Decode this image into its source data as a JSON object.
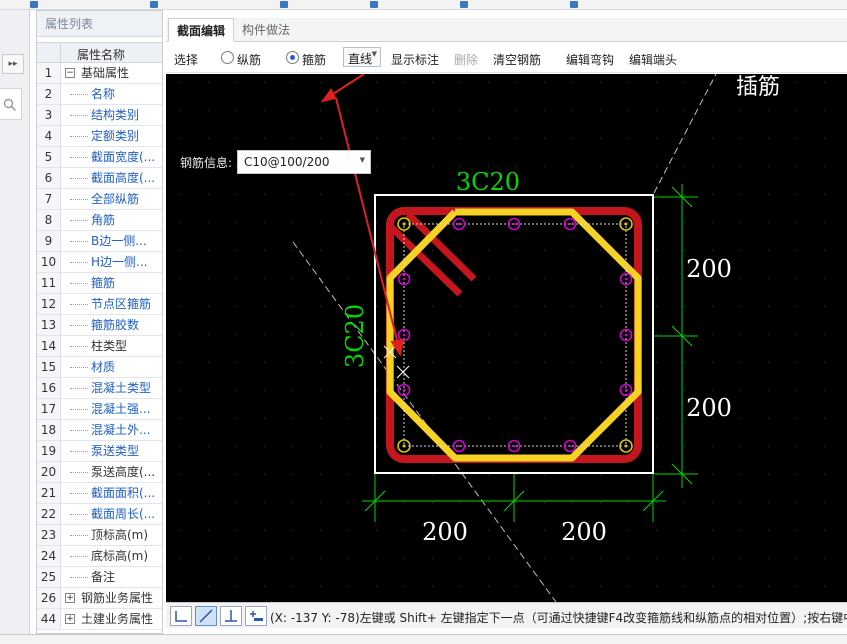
{
  "prop_panel": {
    "title": "属性列表",
    "col_header": "属性名称",
    "rows": [
      {
        "n": "1",
        "label": "基础属性",
        "type": "group",
        "open": true
      },
      {
        "n": "2",
        "label": "名称",
        "blue": true
      },
      {
        "n": "3",
        "label": "结构类别",
        "blue": true
      },
      {
        "n": "4",
        "label": "定额类别",
        "blue": true
      },
      {
        "n": "5",
        "label": "截面宽度(...",
        "blue": true
      },
      {
        "n": "6",
        "label": "截面高度(...",
        "blue": true
      },
      {
        "n": "7",
        "label": "全部纵筋",
        "blue": true
      },
      {
        "n": "8",
        "label": "角筋",
        "blue": true
      },
      {
        "n": "9",
        "label": "B边一侧...",
        "blue": true
      },
      {
        "n": "10",
        "label": "H边一侧...",
        "blue": true
      },
      {
        "n": "11",
        "label": "箍筋",
        "blue": true
      },
      {
        "n": "12",
        "label": "节点区箍筋",
        "blue": true
      },
      {
        "n": "13",
        "label": "箍筋胶数",
        "blue": true
      },
      {
        "n": "14",
        "label": "柱类型",
        "blue": false
      },
      {
        "n": "15",
        "label": "材质",
        "blue": true
      },
      {
        "n": "16",
        "label": "混凝土类型",
        "blue": true
      },
      {
        "n": "17",
        "label": "混凝土强...",
        "blue": true
      },
      {
        "n": "18",
        "label": "混凝土外...",
        "blue": true
      },
      {
        "n": "19",
        "label": "泵送类型",
        "blue": true
      },
      {
        "n": "20",
        "label": "泵送高度(...",
        "blue": false
      },
      {
        "n": "21",
        "label": "截面面积(...",
        "blue": true
      },
      {
        "n": "22",
        "label": "截面周长(...",
        "blue": true
      },
      {
        "n": "23",
        "label": "顶标高(m)",
        "blue": false
      },
      {
        "n": "24",
        "label": "底标高(m)",
        "blue": false
      },
      {
        "n": "25",
        "label": "备注",
        "blue": false
      },
      {
        "n": "26",
        "label": "钢筋业务属性",
        "type": "group",
        "open": false
      },
      {
        "n": "44",
        "label": "土建业务属性",
        "type": "group",
        "open": false
      }
    ]
  },
  "tabs": [
    {
      "label": "截面编辑",
      "active": true
    },
    {
      "label": "构件做法",
      "active": false
    }
  ],
  "toolbar": {
    "select": "选择",
    "radio_longitudinal": "纵筋",
    "radio_stirrup": "箍筋",
    "line_mode": "直线",
    "show_label": "显示标注",
    "delete": "删除",
    "clear_rebar": "清空钢筋",
    "edit_hook": "编辑弯钩",
    "edit_end": "编辑端头"
  },
  "rebar_info": {
    "label": "钢筋信息:",
    "value": "C10@100/200"
  },
  "canvas": {
    "corner_text": "插筋",
    "top_label": "3C20",
    "left_label": "3C20",
    "dim_right_top": "200",
    "dim_right_bottom": "200",
    "dim_bottom_left": "200",
    "dim_bottom_right": "200"
  },
  "status_text": "(X: -137 Y: -78)左键或 Shift+ 左键指定下一点（可通过快捷键F4改变箍筋线和纵筋点的相对位置）;按右键中",
  "colors": {
    "column_outline": "#ffffff",
    "stirrup_outer": "#c4161c",
    "stirrup_inner": "#f5d223",
    "annotation": "#00d800",
    "corner_bar": "#d6c400",
    "side_bar": "#d000d0",
    "arrow": "#e02020"
  }
}
